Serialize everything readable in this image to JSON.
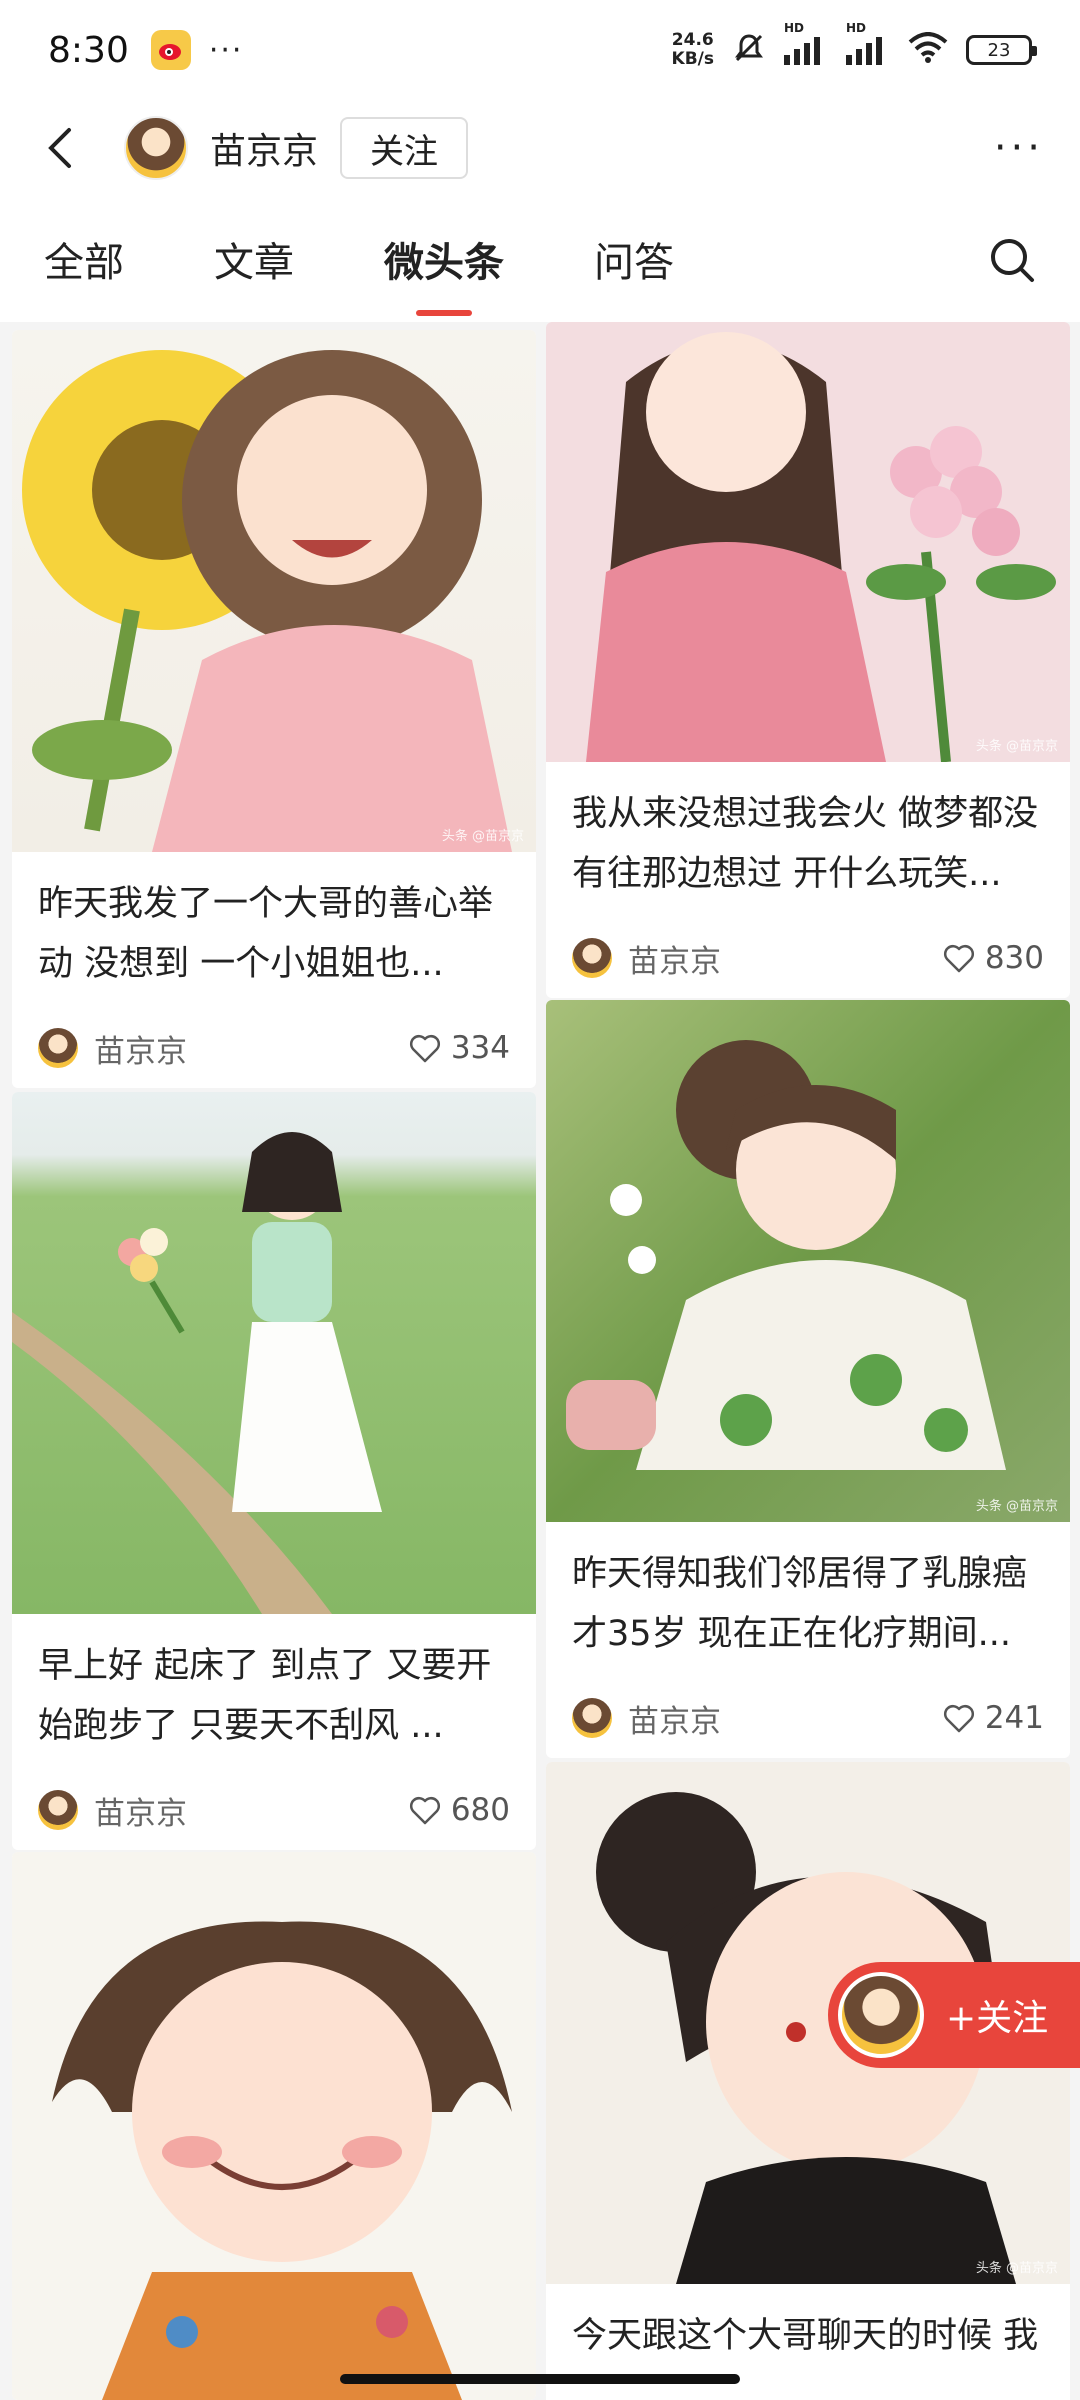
{
  "status_bar": {
    "time": "8:30",
    "app_icon": "weibo-icon",
    "more_dots": "···",
    "net_speed_value": "24.6",
    "net_speed_unit": "KB/s",
    "hd1": "HD",
    "hd2": "HD",
    "battery": "23"
  },
  "header": {
    "author_name": "苗京京",
    "follow_label": "关注",
    "more_label": "···"
  },
  "tabs": [
    {
      "label": "全部"
    },
    {
      "label": "文章"
    },
    {
      "label": "微头条"
    },
    {
      "label": "问答"
    }
  ],
  "active_tab": "微头条",
  "watermark": "头条 @苗京京",
  "cards": [
    {
      "title": "昨天我发了一个大哥的善心举动 没想到 一个小姐姐也...",
      "author": "苗京京",
      "likes": "334",
      "image": "girl-with-sunflower"
    },
    {
      "title": "我从来没想过我会火 做梦都没有往那边想过 开什么玩笑...",
      "author": "苗京京",
      "likes": "830",
      "image": "girl-with-roses"
    },
    {
      "title": "早上好 起床了 到点了 又要开始跑步了 只要天不刮风 ...",
      "author": "苗京京",
      "likes": "680",
      "image": "girl-in-meadow"
    },
    {
      "title": "昨天得知我们邻居得了乳腺癌才35岁 现在正在化疗期间...",
      "author": "苗京京",
      "likes": "241",
      "image": "girl-with-clover-dress"
    },
    {
      "title": "",
      "author": "",
      "likes": "",
      "image": "girl-smiling-curly-hair"
    },
    {
      "title": "今天跟这个大哥聊天的时候 我",
      "author": "",
      "likes": "",
      "image": "girl-black-sweater"
    }
  ],
  "float_follow_label": "+关注",
  "colors": {
    "accent": "#e8453c",
    "background": "#f4f4f4"
  }
}
